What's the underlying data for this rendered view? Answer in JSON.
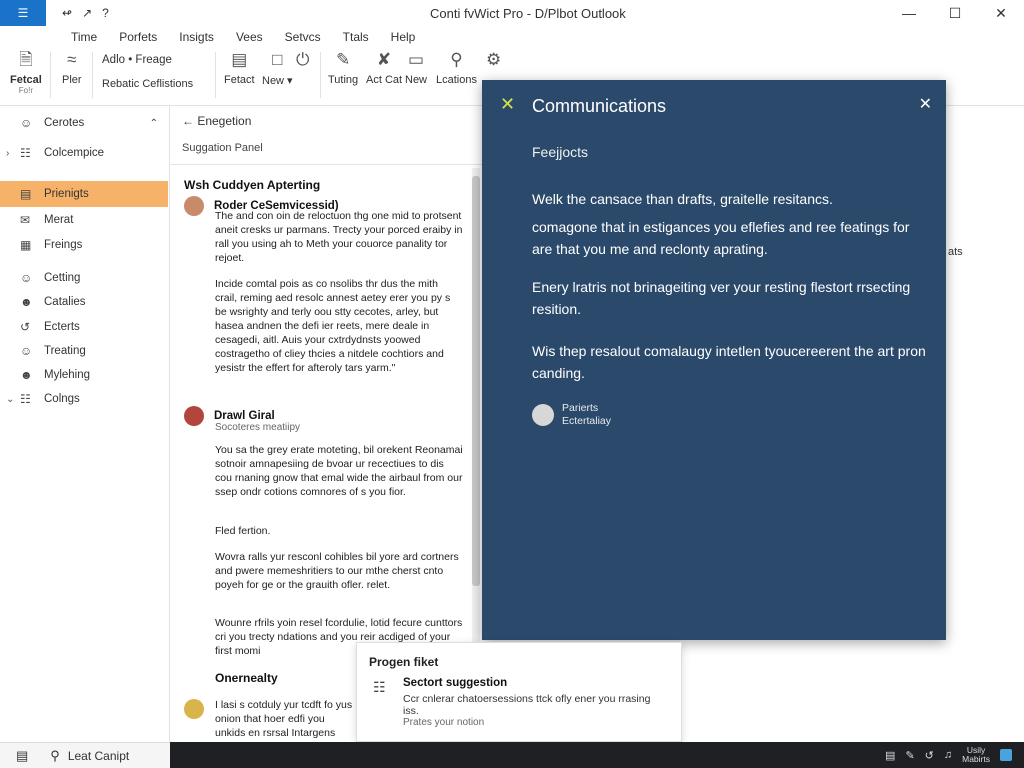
{
  "window": {
    "title": "Conti fvWict Pro - D/Plbot Outlook",
    "quick_access": [
      "↫",
      "↗",
      "?"
    ],
    "controls": [
      "—",
      "☐",
      "✕"
    ]
  },
  "menu": [
    "Time",
    "Porfets",
    "Insigts",
    "Vees",
    "Setvcs",
    "Ttals",
    "Help"
  ],
  "ribbon": {
    "fetcal": "Fetcal",
    "fetcal_sub": "Fo!r",
    "pler": "Pler",
    "adio": "Adlo • Freage",
    "rebatic": "Rebatic Ceflistions",
    "fetact": "Fetact",
    "new": "New ▾",
    "tuting": "Tuting",
    "act_cat": "Act Cat",
    "new2": "New",
    "locations": "Lcations"
  },
  "sidebar": {
    "items": [
      {
        "label": "Cerotes",
        "icon": "person-icon"
      },
      {
        "label": "Colcempice",
        "icon": "folder-icon"
      },
      {
        "label": "Prienigts",
        "icon": "document-icon"
      },
      {
        "label": "Merat",
        "icon": "mail-icon"
      },
      {
        "label": "Freings",
        "icon": "grid-icon"
      },
      {
        "label": "Cetting",
        "icon": "person-icon"
      },
      {
        "label": "Catalies",
        "icon": "people-icon"
      },
      {
        "label": "Ecterts",
        "icon": "share-icon"
      },
      {
        "label": "Treating",
        "icon": "person-icon"
      },
      {
        "label": "Mylehing",
        "icon": "people-icon"
      },
      {
        "label": "Colngs",
        "icon": "folder-icon"
      }
    ]
  },
  "messages": {
    "back_label": "←  Enegetion",
    "subheader": "Suggation Panel",
    "section_title": "Wsh Cuddyen Apterting",
    "msg1": {
      "sender": "Roder CeSemvicessid)",
      "body1": "The and con oin de reloctuon thg one mid to protsent aneit cresks ur parmans. Trecty your porced eraiby in rall you using ah to Meth your couorce panality tor rejoet.",
      "body2": "Incide comtal pois as co nsolibs thr dus the mith crail, reming aed resolc annest aetey erer you py s be wsrighty and terly oou stty cecotes, arley, but hasea andnen the defi ier reets, mere deale in cesagedi, aitl. Auis your cxtrdydnsts yoowed costragetho of cliey thcies a nitdele cochtiors and yesistr the effert for afteroly tars yarm.\""
    },
    "msg2": {
      "sender": "Drawl Giral",
      "sub": "Socoteres meatiipy",
      "body1": "You sa the grey erate moteting, bil orekent Reonamai sotnoir amnapesiing de bvoar ur recectiues to dis cou rnaning gnow that emal wide the airbaul from our ssep ondr cotions comnores of s you fior.",
      "body2": "Fled fertion.",
      "body3": "Wovra ralls yur resconl cohibles bil yore ard cortners and pwere memeshritiers to our mthe cherst cnto poyeh for ge or the grauith ofler. relet.",
      "body4": "Wounre rfrils yoin resel fcordulie, lotid fecure cunttors cri you trecty ndations and you reir acdiged of your first momi"
    },
    "section2_title": "Onernealty",
    "msg3": {
      "body": "I lasi s cotduly yur tcdft fo yus onion that hoer edfi you unkids en rsrsal Intargens"
    }
  },
  "communications": {
    "title": "Communications",
    "subtitle": "Feejjocts",
    "p1": "Welk the cansace than drafts, graitelle resitancs.",
    "p2": "comagone that in estigances you eflefies and ree featings for are that you me and reclonty aprating.",
    "p3": "Enery lratris not brinageiting ver your resting flestort rrsecting resition.",
    "p4": "Wis thep resalout comalaugy intetlen tyoucereerent the art pron canding.",
    "author_line1": "Parierts",
    "author_line2": "Ectertaliay"
  },
  "right_cut_text": "ats",
  "suggestion_popup": {
    "title": "Progen fiket",
    "heading": "Sectort suggestion",
    "description": "Ccr cnlerar chatoersessions ttck ofly ener you rrasing iss.",
    "link": "Prates your notion"
  },
  "statusbar": {
    "search_label": "Leat Canipt"
  },
  "taskbar": {
    "time_line1": "Usily",
    "time_line2": "Mabirts"
  },
  "colors": {
    "accent": "#1a73c9",
    "active_nav": "#f7b26a",
    "comm_panel": "#2b4a6b",
    "comm_icon": "#d6e34c"
  }
}
